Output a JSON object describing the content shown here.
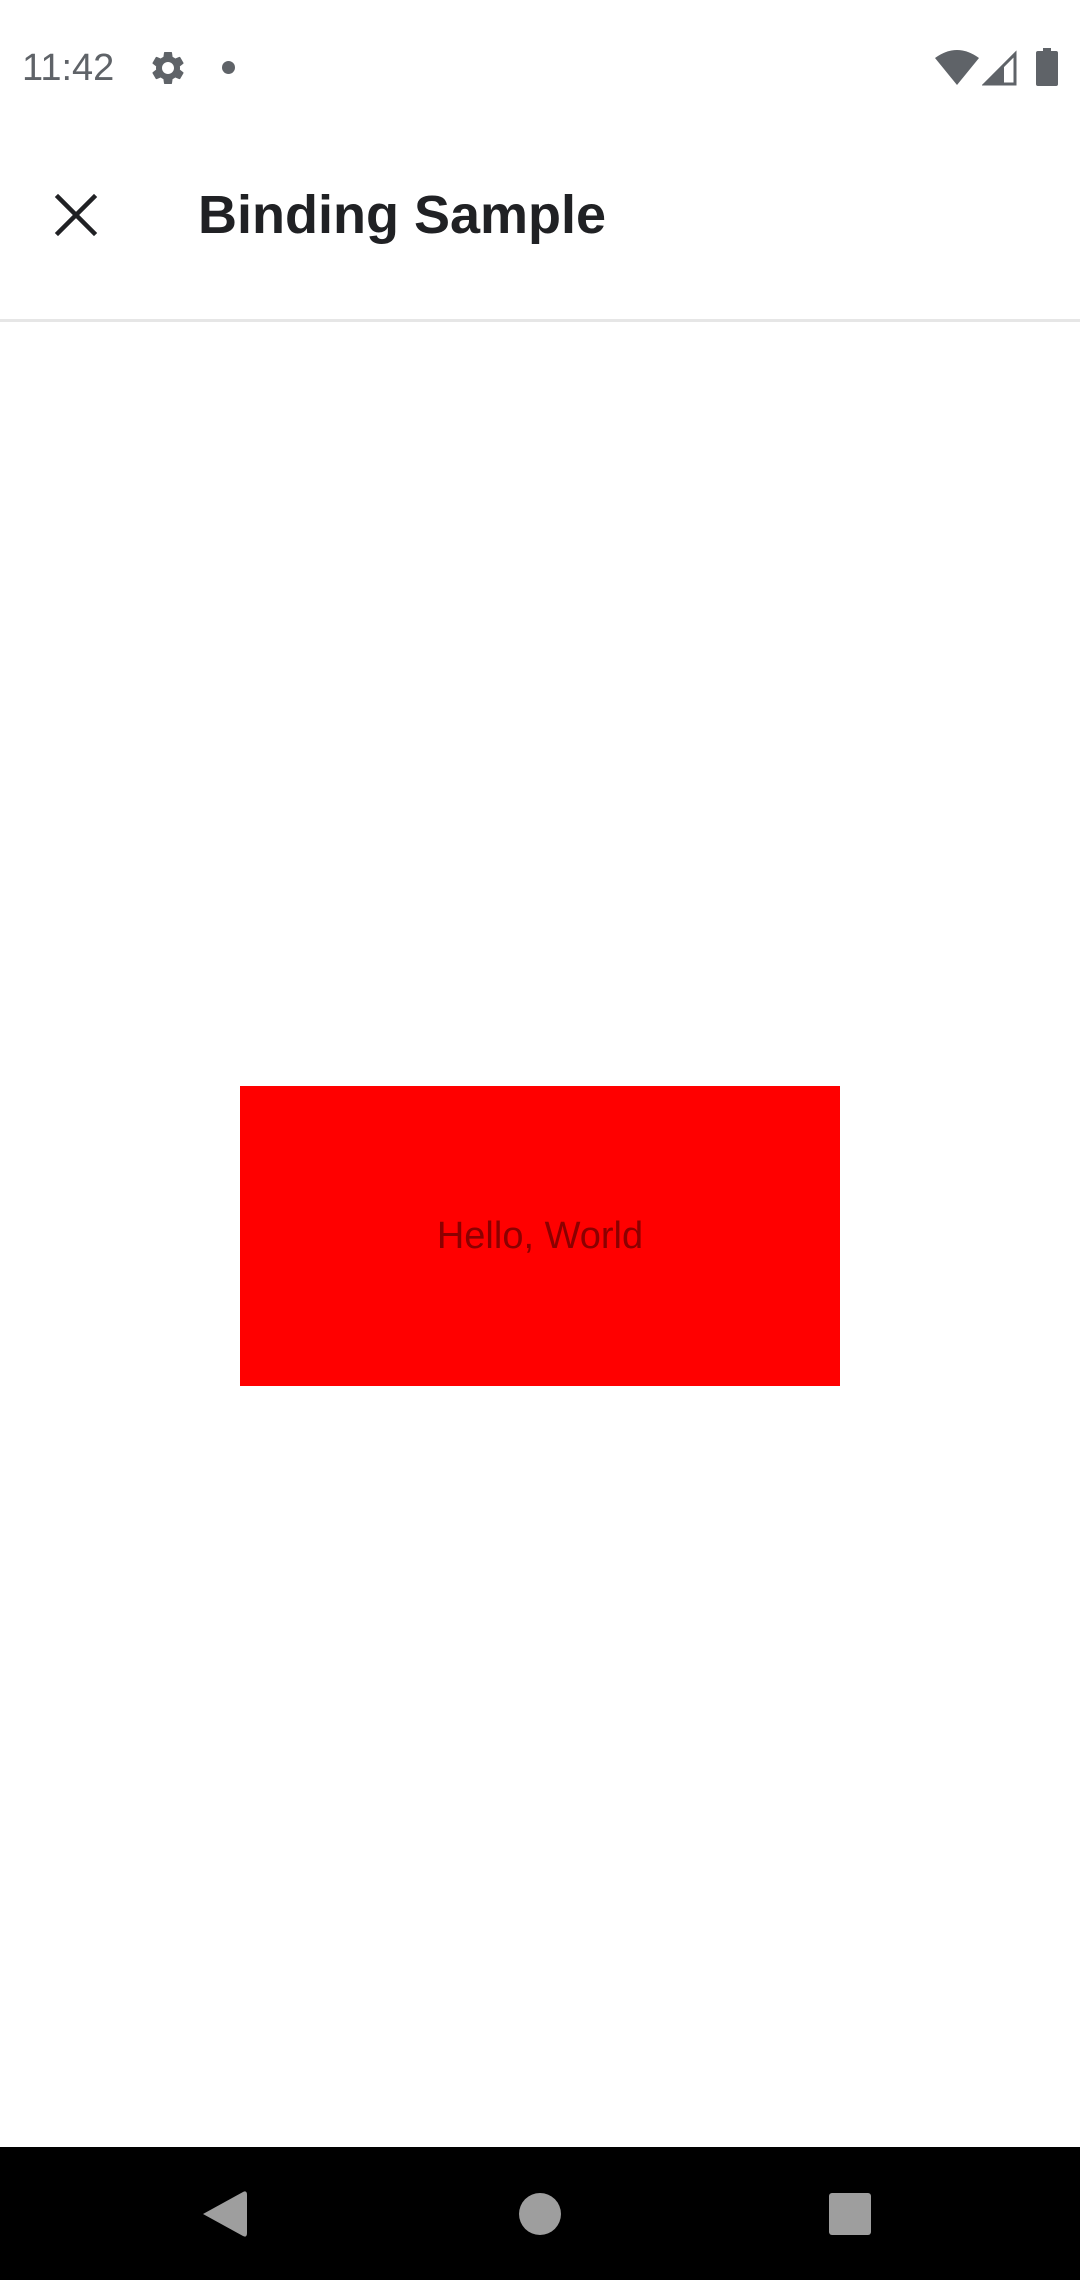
{
  "status_bar": {
    "time": "11:42",
    "icons": [
      "gear-icon",
      "notification-dot-icon",
      "wifi-icon",
      "cell-signal-icon",
      "battery-icon"
    ],
    "icon_color": "#5f6368"
  },
  "app_bar": {
    "title": "Binding Sample",
    "close_icon": "close-icon",
    "divider_color": "#e6e6e6"
  },
  "content": {
    "box_text": "Hello, World",
    "box_color": "#ff0000",
    "text_color": "#8b0000"
  },
  "nav_bar": {
    "background": "#000000",
    "icon_color": "#9e9e9e",
    "buttons": [
      "back-icon",
      "home-icon",
      "recents-icon"
    ]
  }
}
